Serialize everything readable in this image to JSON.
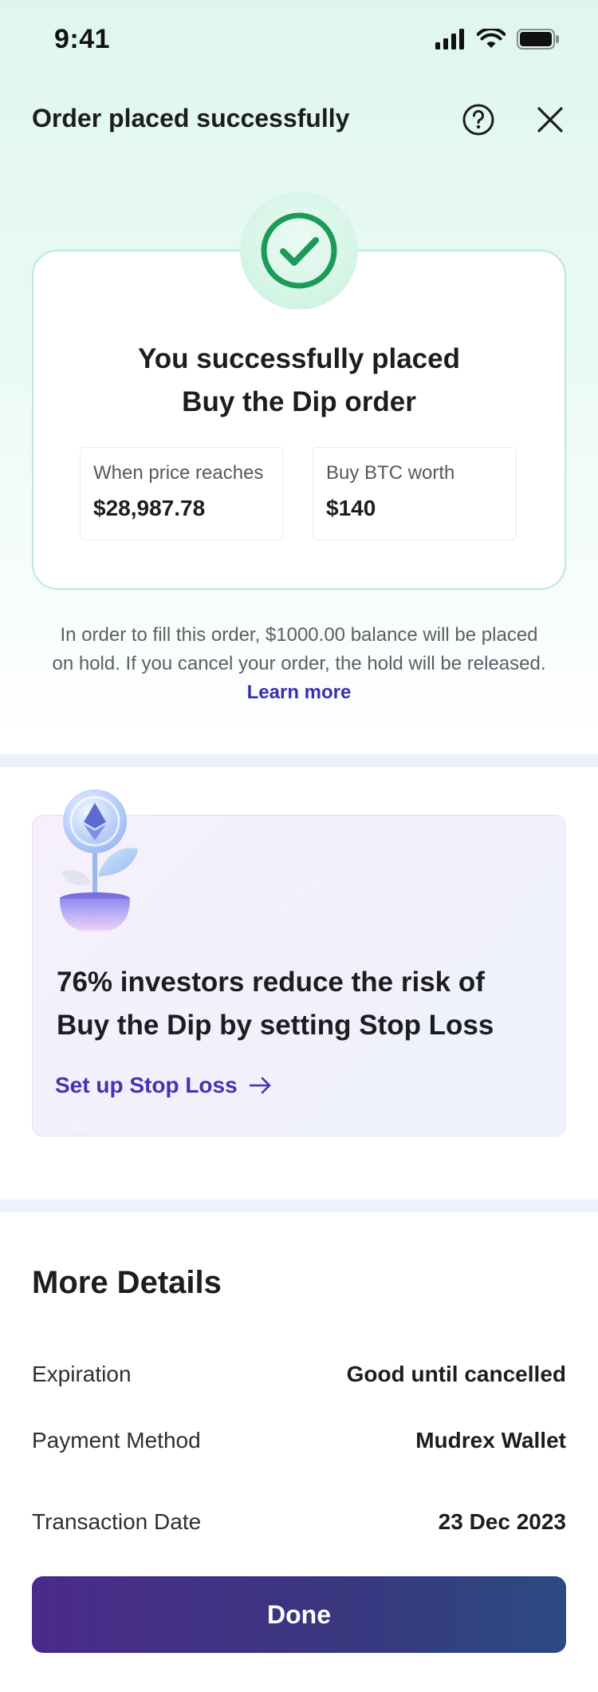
{
  "status_bar": {
    "time": "9:41"
  },
  "header": {
    "title": "Order placed successfully",
    "help_icon": "question-circle-icon",
    "close_icon": "close-icon"
  },
  "success_card": {
    "icon": "check-circle-icon",
    "heading_line1": "You successfully placed",
    "heading_line2": "Buy the Dip order",
    "trigger_label": "When price reaches",
    "trigger_value": "$28,987.78",
    "amount_label": "Buy BTC worth",
    "amount_value": "$140"
  },
  "hold_note": {
    "line1": "In order to fill this order, $1000.00  balance will be placed",
    "line2": "on hold. If you cancel your order, the hold will be released.",
    "link": "Learn more"
  },
  "promo": {
    "illustration": "ethereum-plant-icon",
    "text_line1": "76% investors reduce the risk of",
    "text_line2": "Buy the Dip by setting Stop Loss",
    "cta": "Set up Stop Loss"
  },
  "details": {
    "title": "More Details",
    "rows": [
      {
        "label": "Expiration",
        "value": "Good until cancelled"
      },
      {
        "label": "Payment Method",
        "value": "Mudrex Wallet"
      },
      {
        "label": "Transaction Date",
        "value": "23 Dec 2023"
      }
    ]
  },
  "done_button": {
    "label": "Done"
  },
  "colors": {
    "accent": "#3a2fb0",
    "success": "#1e9a58",
    "button_start": "#4a2a8a",
    "button_end": "#2b4a82"
  }
}
